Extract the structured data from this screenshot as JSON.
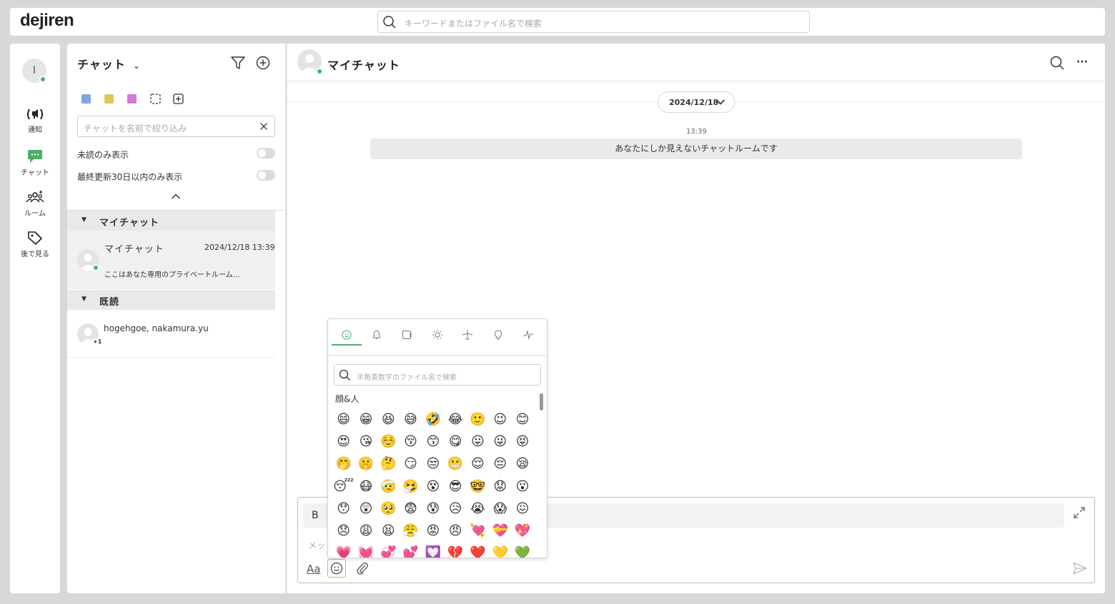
{
  "app": {
    "logo": "dejiren"
  },
  "search": {
    "placeholder": "キーワードまたはファイル名で検索"
  },
  "user": {
    "initial": "I"
  },
  "nav": {
    "items": [
      {
        "label": "通知",
        "icon": "broadcast-icon",
        "color": "#333333"
      },
      {
        "label": "チャット",
        "icon": "chat-bubble-icon",
        "color": "#4cae6a"
      },
      {
        "label": "ルーム",
        "icon": "people-icon",
        "color": "#333333"
      },
      {
        "label": "後で見る",
        "icon": "tag-icon",
        "color": "#333333"
      }
    ]
  },
  "chatlist": {
    "title": "チャット",
    "filter_placeholder": "チャットを名前で絞り込み",
    "color_filters": [
      "#7fa7e0",
      "#e0c65a",
      "#d27ad4"
    ],
    "toggles": [
      {
        "label": "未読のみ表示",
        "on": false
      },
      {
        "label": "最終更新30日以内のみ表示",
        "on": false
      }
    ],
    "sections": [
      {
        "title": "マイチャット",
        "items": [
          {
            "name": "マイチャット",
            "time": "2024/12/18 13:39",
            "preview": "ここはあなた専用のプライベートルーム..."
          }
        ]
      },
      {
        "title": "既読",
        "items": [
          {
            "name": "hogehgoe, nakamura.yu",
            "badge": "+1"
          }
        ]
      }
    ]
  },
  "chat": {
    "title": "マイチャット",
    "date": "2024/12/18",
    "message_time": "13:39",
    "system_message": "あなたにしか見えないチャットルームです",
    "composer": {
      "bold_label": "B",
      "placeholder": "メッ",
      "format_label": "Aa"
    }
  },
  "emoji_picker": {
    "tabs": [
      "smiley-icon",
      "bell-icon",
      "square-icon",
      "sun-icon",
      "airplane-icon",
      "lightbulb-icon",
      "pulse-icon"
    ],
    "search_placeholder": "半角英数字のファイル名で検索",
    "category": "顔&人",
    "rows": [
      [
        "😄",
        "😁",
        "😆",
        "😅",
        "🤣",
        "😂",
        "🙂",
        "😉",
        "😊"
      ],
      [
        "😍",
        "😘",
        "☺️",
        "😚",
        "😙",
        "😋",
        "😛",
        "😜",
        "😝"
      ],
      [
        "🤭",
        "🤫",
        "🤔",
        "😏",
        "😒",
        "😬",
        "😌",
        "😔",
        "😪"
      ],
      [
        "😴",
        "😷",
        "🤕",
        "🤧",
        "😵",
        "😎",
        "🤓",
        "😟",
        "😮"
      ],
      [
        "😯",
        "😲",
        "🥺",
        "😨",
        "😰",
        "😥",
        "😭",
        "😱",
        "😖"
      ],
      [
        "😞",
        "😩",
        "😫",
        "😤",
        "😡",
        "😠",
        "💘",
        "💝",
        "💖"
      ],
      [
        "💗",
        "💓",
        "💞",
        "💕",
        "💟",
        "💔",
        "❤️",
        "💛",
        "💚"
      ]
    ]
  }
}
